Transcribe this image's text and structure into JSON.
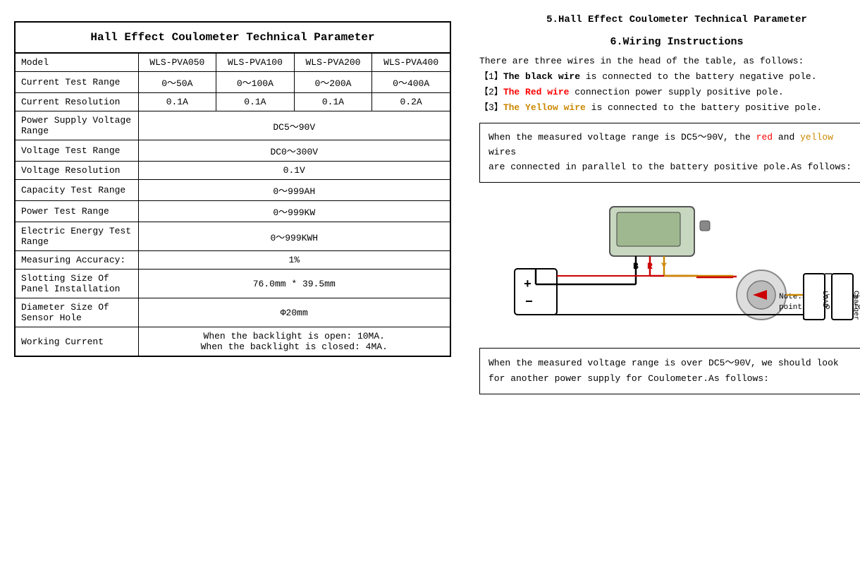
{
  "left": {
    "table_title": "Hall Effect Coulometer Technical Parameter",
    "headers": [
      "Model",
      "WLS-PVA050",
      "WLS-PVA100",
      "WLS-PVA200",
      "WLS-PVA400"
    ],
    "rows": [
      {
        "label": "Current Test Range",
        "values": [
          "0～50A",
          "0～100A",
          "0～200A",
          "0～400A"
        ],
        "span": false
      },
      {
        "label": "Current Resolution",
        "values": [
          "0.1A",
          "0.1A",
          "0.1A",
          "0.2A"
        ],
        "span": false
      },
      {
        "label": "Power Supply Voltage Range",
        "values": [
          "DC5～90V"
        ],
        "span": true
      },
      {
        "label": "Voltage Test Range",
        "values": [
          "DC0～300V"
        ],
        "span": true
      },
      {
        "label": "Voltage Resolution",
        "values": [
          "0.1V"
        ],
        "span": true
      },
      {
        "label": "Capacity Test Range",
        "values": [
          "0～999AH"
        ],
        "span": true
      },
      {
        "label": "Power Test Range",
        "values": [
          "0～999KW"
        ],
        "span": true
      },
      {
        "label": "Electric Energy Test Range",
        "values": [
          "0～999KWH"
        ],
        "span": true
      },
      {
        "label": "Measuring Accuracy:",
        "values": [
          "1%"
        ],
        "span": true
      },
      {
        "label": "Slotting Size Of Panel Installation",
        "values": [
          "76.0mm * 39.5mm"
        ],
        "span": true
      },
      {
        "label": "Diameter Size Of Sensor Hole",
        "values": [
          "Φ20mm"
        ],
        "span": true
      },
      {
        "label": "Working Current",
        "values": [
          "When the backlight is open: 10MA.\nWhen the backlight is closed: 4MA."
        ],
        "span": true
      }
    ]
  },
  "right": {
    "section5_title": "5.Hall Effect Coulometer Technical Parameter",
    "section6_title": "6.Wiring Instructions",
    "wiring_intro": "There are three wires in the head of the table, as follows:",
    "wire1": "The black wire is connected to the battery negative pole.",
    "wire2": "The Red wire connection power supply positive pole.",
    "wire3": "The Yellow wire is connected to the battery positive pole.",
    "info_box1_line1": "When the measured voltage range is DC5～90V, the ",
    "info_box1_line1b": "red",
    "info_box1_line1c": " and ",
    "info_box1_line1d": "yellow",
    "info_box1_line1e": " wires",
    "info_box1_line2": "are connected in parallel to the battery positive pole.As follows:",
    "diagram_labels": {
      "b": "B",
      "r": "R",
      "y": "Y",
      "note": "Note:Sensor arrow\npointing to the load",
      "load": "LOAD",
      "charger": "Charger"
    },
    "bottom_box_line1": "When the measured voltage range is over DC5～90V, we should  look",
    "bottom_box_line2": "for another power supply for Coulometer.As follows:"
  }
}
